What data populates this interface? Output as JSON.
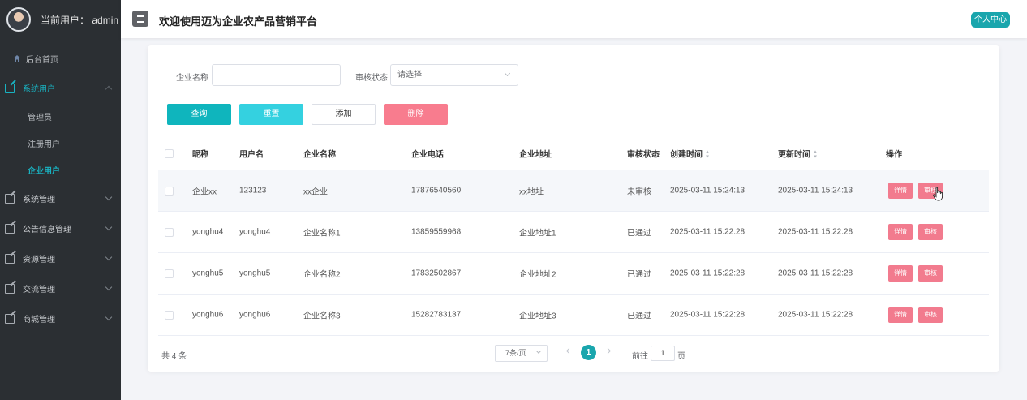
{
  "sidebar": {
    "user_label": "当前用户：",
    "user_name": "admin",
    "home": "后台首页",
    "system_users": "系统用户",
    "sub_admin": "管理员",
    "sub_registered": "注册用户",
    "sub_enterprise": "企业用户",
    "system_manage": "系统管理",
    "notice_manage": "公告信息管理",
    "resource_manage": "资源管理",
    "exchange_manage": "交流管理",
    "mall_manage": "商城管理"
  },
  "header": {
    "title": "欢迎使用迈为企业农产品营销平台",
    "profile": "个人中心"
  },
  "filters": {
    "company_label": "企业名称",
    "company_value": "",
    "status_label": "审核状态",
    "status_placeholder": "请选择"
  },
  "buttons": {
    "search": "查询",
    "reset": "重置",
    "add": "添加",
    "delete": "删除"
  },
  "table": {
    "headers": {
      "nickname": "昵称",
      "username": "用户名",
      "company": "企业名称",
      "phone": "企业电话",
      "address": "企业地址",
      "status": "审核状态",
      "created": "创建时间",
      "updated": "更新时间",
      "ops": "操作"
    },
    "detail_label": "详情",
    "audit_label": "审核",
    "rows": [
      {
        "nickname": "企业xx",
        "username": "123123",
        "company": "xx企业",
        "phone": "17876540560",
        "address": "xx地址",
        "status": "未审核",
        "created": "2025-03-11 15:24:13",
        "updated": "2025-03-11 15:24:13"
      },
      {
        "nickname": "yonghu4",
        "username": "yonghu4",
        "company": "企业名称1",
        "phone": "13859559968",
        "address": "企业地址1",
        "status": "已通过",
        "created": "2025-03-11 15:22:28",
        "updated": "2025-03-11 15:22:28"
      },
      {
        "nickname": "yonghu5",
        "username": "yonghu5",
        "company": "企业名称2",
        "phone": "17832502867",
        "address": "企业地址2",
        "status": "已通过",
        "created": "2025-03-11 15:22:28",
        "updated": "2025-03-11 15:22:28"
      },
      {
        "nickname": "yonghu6",
        "username": "yonghu6",
        "company": "企业名称3",
        "phone": "15282783137",
        "address": "企业地址3",
        "status": "已通过",
        "created": "2025-03-11 15:22:28",
        "updated": "2025-03-11 15:22:28"
      }
    ]
  },
  "pagination": {
    "total": "共 4 条",
    "page_size": "7条/页",
    "current_page": "1",
    "goto_prefix": "前往",
    "goto_value": "1",
    "goto_suffix": "页"
  },
  "colors": {
    "accent": "#1aa6ad",
    "search_btn": "#0fb5bd",
    "reset_btn": "#34d1e0",
    "delete_btn": "#f87c8e",
    "op_btn": "#f27b8e",
    "sidebar_bg": "#2b2f33"
  }
}
